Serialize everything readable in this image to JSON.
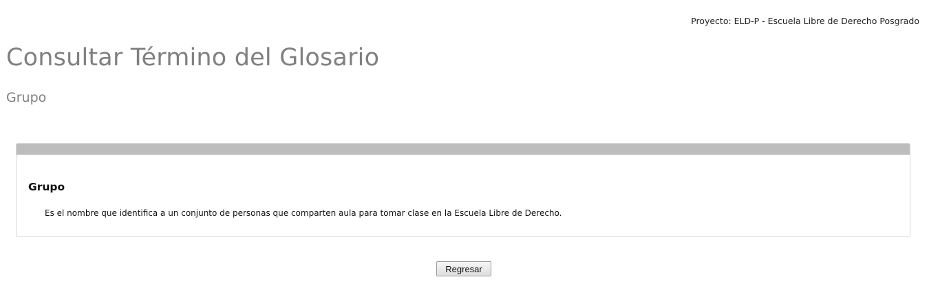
{
  "header": {
    "project": "Proyecto: ELD-P - Escuela Libre de Derecho Posgrado"
  },
  "page": {
    "title": "Consultar Término del Glosario",
    "subtitle": "Grupo"
  },
  "term": {
    "name": "Grupo",
    "definition": "Es el nombre que identifica a un conjunto de personas que comparten aula para tomar clase en la Escuela Libre de Derecho."
  },
  "actions": {
    "back_label": "Regresar"
  }
}
